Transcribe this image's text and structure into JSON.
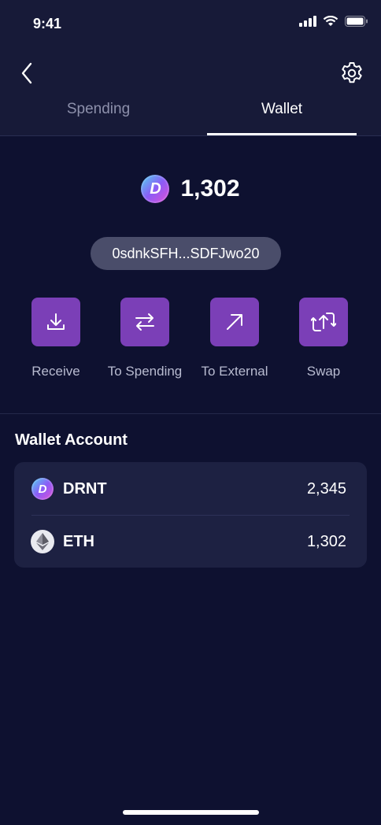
{
  "status_bar": {
    "time": "9:41"
  },
  "header": {
    "tabs": [
      {
        "label": "Spending",
        "active": false
      },
      {
        "label": "Wallet",
        "active": true
      }
    ]
  },
  "balance": {
    "value": "1,302",
    "coin_glyph": "D"
  },
  "address": "0sdnkSFH...SDFJwo20",
  "actions": [
    {
      "label": "Receive",
      "icon": "download-icon"
    },
    {
      "label": "To Spending",
      "icon": "transfer-arrows-icon"
    },
    {
      "label": "To External",
      "icon": "arrow-up-right-icon"
    },
    {
      "label": "Swap",
      "icon": "swap-icon"
    }
  ],
  "wallet_account": {
    "title": "Wallet Account",
    "tokens": [
      {
        "name": "DRNT",
        "amount": "2,345",
        "icon": "drnt-coin-icon"
      },
      {
        "name": "ETH",
        "amount": "1,302",
        "icon": "ethereum-icon"
      }
    ]
  },
  "colors": {
    "background": "#0e1130",
    "header": "#171a38",
    "action_tile": "#7b3fb7",
    "card": "#1d2142",
    "address_pill": "#4a4d6a"
  }
}
